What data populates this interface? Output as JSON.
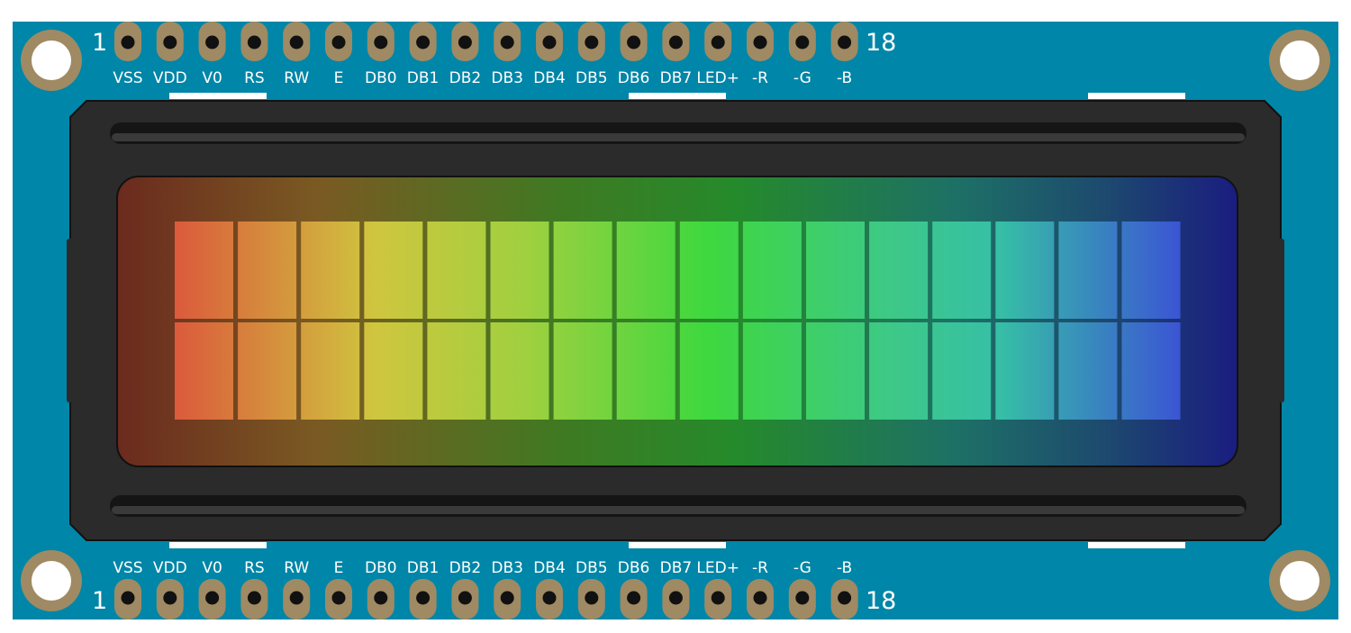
{
  "pins": [
    "VSS",
    "VDD",
    "V0",
    "RS",
    "RW",
    "E",
    "DB0",
    "DB1",
    "DB2",
    "DB3",
    "DB4",
    "DB5",
    "DB6",
    "DB7",
    "LED+",
    "-R",
    "-G",
    "-B"
  ],
  "pin_first": "1",
  "pin_last": "18",
  "display": {
    "columns": 16,
    "rows": 2
  },
  "colors": {
    "board": "#0086A8",
    "pad": "#9F8A63",
    "bezel": "#2B2B2B",
    "pin_hole": "#111111"
  }
}
